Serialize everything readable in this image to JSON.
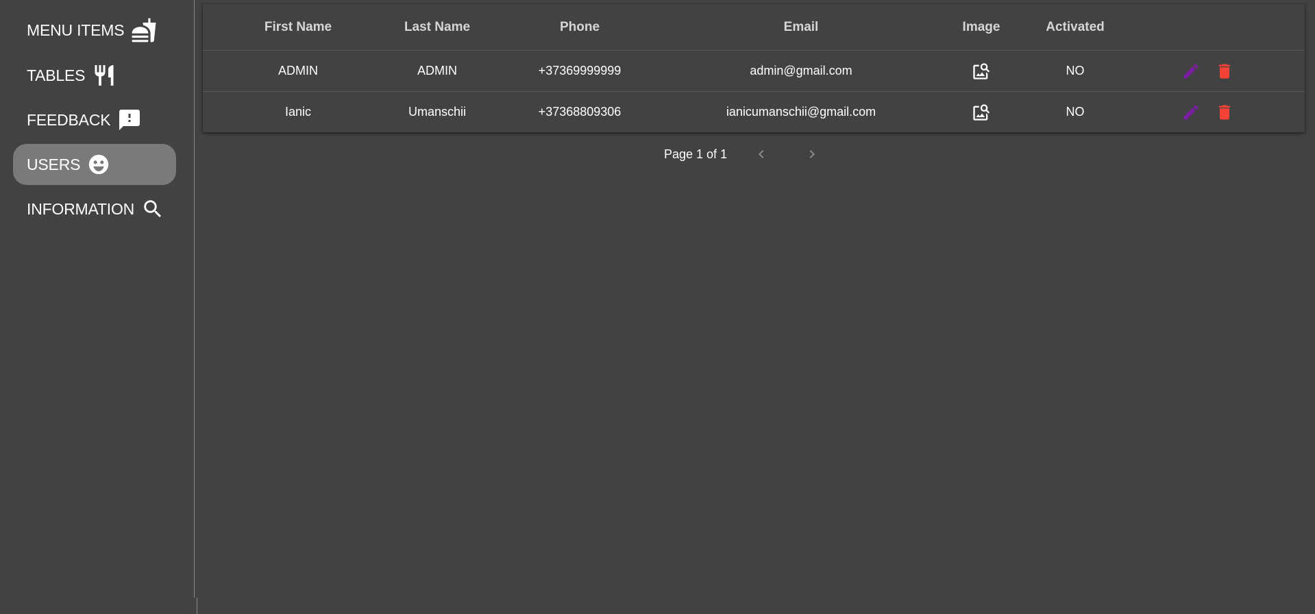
{
  "sidebar": {
    "items": [
      {
        "label": "MENU ITEMS",
        "icon": "fastfood-icon"
      },
      {
        "label": "TABLES",
        "icon": "restaurant-icon"
      },
      {
        "label": "FEEDBACK",
        "icon": "feedback-icon"
      },
      {
        "label": "USERS",
        "icon": "face-icon",
        "active": true
      },
      {
        "label": "INFORMATION",
        "icon": "search-icon"
      }
    ]
  },
  "table": {
    "headers": {
      "first_name": "First Name",
      "last_name": "Last Name",
      "phone": "Phone",
      "email": "Email",
      "image": "Image",
      "activated": "Activated"
    },
    "rows": [
      {
        "first_name": "ADMIN",
        "last_name": "ADMIN",
        "phone": "+37369999999",
        "email": "admin@gmail.com",
        "activated": "NO"
      },
      {
        "first_name": "Ianic",
        "last_name": "Umanschii",
        "phone": "+37368809306",
        "email": "ianicumanschii@gmail.com",
        "activated": "NO"
      }
    ]
  },
  "pagination": {
    "label": "Page 1 of 1"
  },
  "colors": {
    "background": "#424242",
    "active_nav": "#7a7a7a",
    "edit_icon": "#7b1fa2",
    "delete_icon": "#f44336"
  }
}
